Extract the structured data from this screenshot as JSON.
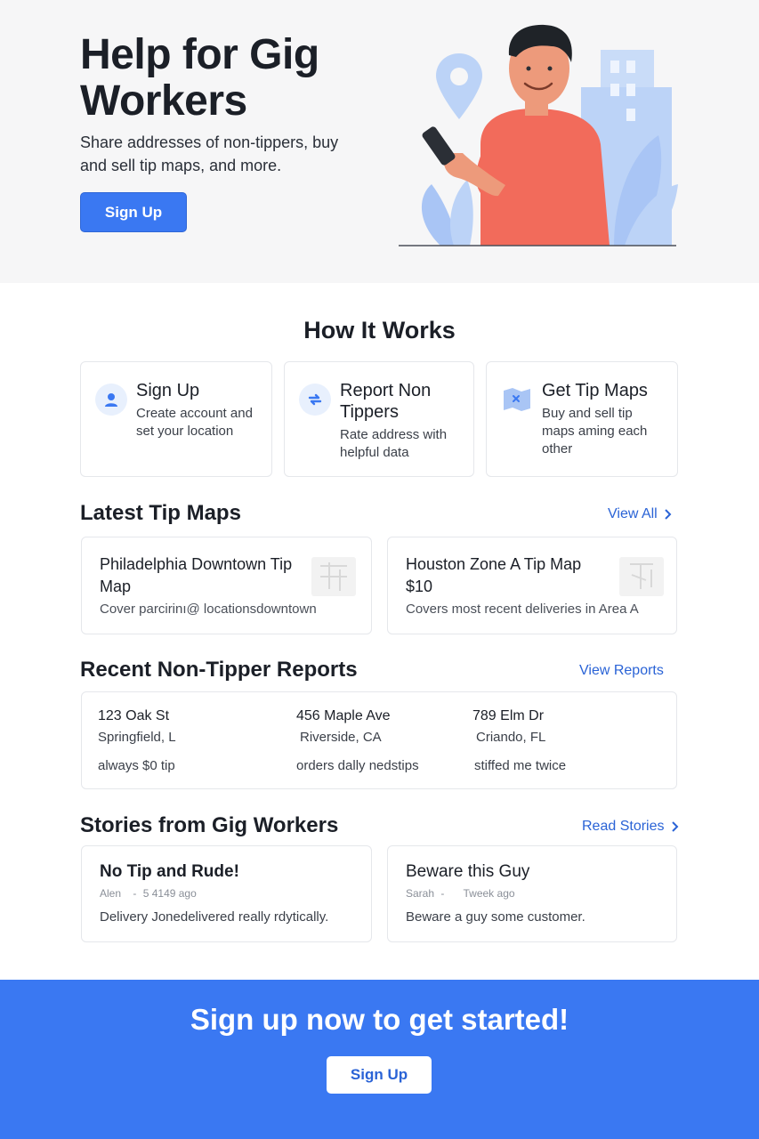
{
  "hero": {
    "title": "Help for Gig Workers",
    "subtitle": "Share addresses of non-tippers, buy and sell tip maps, and more.",
    "signup_label": "Sign Up"
  },
  "how_it_works": {
    "title": "How It Works",
    "steps": [
      {
        "title": "Sign Up",
        "desc": "Create account and set your location",
        "icon": "user-icon"
      },
      {
        "title": "Report Non Tippers",
        "desc": "Rate address with helpful data",
        "icon": "swap-arrows-icon"
      },
      {
        "title": "Get Tip Maps",
        "desc": "Buy and sell tip maps aming each other",
        "icon": "map-icon"
      }
    ]
  },
  "tip_maps": {
    "title": "Latest Tip Maps",
    "link": "View All",
    "items": [
      {
        "title": "Philadelphia Downtown Tip Map",
        "desc": "Cover parcirinı@ locationsdowntown"
      },
      {
        "title": "Houston Zone A Tip Map $10",
        "desc": "Covers most recent deliveries in Area A"
      }
    ]
  },
  "reports": {
    "title": "Recent Non-Tipper Reports",
    "link": "View Reports",
    "items": [
      {
        "address": "123 Oak St",
        "city": "Springfield, L",
        "note": "always $0 tip"
      },
      {
        "address": "456 Maple Ave",
        "city": "Riverside, CA",
        "note": "orders dally nedstips"
      },
      {
        "address": "789 Elm Dr",
        "city": "Criando, FL",
        "note": "stiffed me twice"
      }
    ]
  },
  "stories": {
    "title": "Stories from Gig Workers",
    "link": "Read Stories",
    "items": [
      {
        "title": "No Tip and Rude!",
        "author": "Alen",
        "time": "5 4149 ago",
        "text": "Delivery Jonedelivered really rdytically."
      },
      {
        "title": "Beware this Guy",
        "author": "Sarah",
        "time": "Tweek ago",
        "text": "Beware a guy some customer."
      }
    ]
  },
  "cta": {
    "title": "Sign up now to get started!",
    "button": "Sign Up"
  },
  "colors": {
    "accent": "#3a78f2",
    "link": "#2a63d6",
    "shirt": "#f26b5b",
    "light_blue": "#bcd3f7"
  }
}
